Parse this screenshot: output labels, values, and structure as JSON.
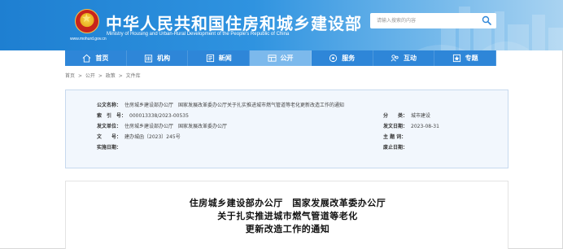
{
  "header": {
    "title": "中华人民共和国住房和城乡建设部",
    "subtitle": "Ministry of Housing and Urban-Rural Development of the People's Republic of China",
    "url": "www.mohurd.gov.cn"
  },
  "search": {
    "placeholder": "请输入搜索的内容"
  },
  "nav": {
    "items": [
      {
        "label": "首页",
        "icon": "home-icon"
      },
      {
        "label": "机构",
        "icon": "building-icon"
      },
      {
        "label": "新闻",
        "icon": "news-icon"
      },
      {
        "label": "公开",
        "icon": "open-icon",
        "active": true
      },
      {
        "label": "服务",
        "icon": "service-icon"
      },
      {
        "label": "互动",
        "icon": "interact-icon"
      },
      {
        "label": "专题",
        "icon": "topic-icon"
      }
    ]
  },
  "breadcrumb": [
    "首页",
    ">",
    "公开",
    ">",
    "政策",
    ">",
    "文件库"
  ],
  "info": {
    "issuer_label": "公文名称：",
    "issuer_value": "住房城乡建设部办公厅　国家发展改革委办公厅关于扎实推进城市燃气管道等老化更新改造工作的通知",
    "index_label": "索　引　号：",
    "index_value": "000013338/2023-00535",
    "category_label": "分　　类：",
    "category_value": "城市建设",
    "dept_label": "发文单位：",
    "dept_value": "住房城乡建设部办公厅　国家发展改革委办公厅",
    "date_label": "发文日期：",
    "date_value": "2023-08-31",
    "doc_label": "文　　号：",
    "doc_value": "建办城函〔2023〕245号",
    "topic_label": "主 题 词：",
    "topic_value": "",
    "impl_label": "实施日期：",
    "impl_value": "",
    "expire_label": "废止日期：",
    "expire_value": ""
  },
  "article": {
    "title_line1": "住房城乡建设部办公厅　国家发展改革委办公厅",
    "title_line2": "关于扎实推进城市燃气管道等老化",
    "title_line3": "更新改造工作的通知"
  },
  "colors": {
    "header_blue": "#1e7fd1",
    "nav_blue": "#2e86d8",
    "nav_active": "#7cb9ec",
    "info_bg": "#f2f7fd"
  }
}
